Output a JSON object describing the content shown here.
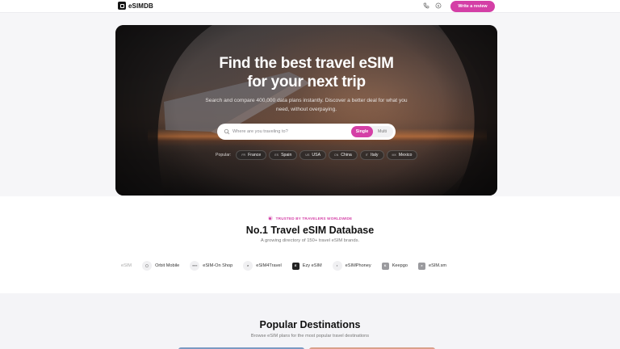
{
  "header": {
    "brand": "eSIMDB",
    "icons": [
      "phone-icon",
      "dollar-icon"
    ],
    "cta_label": "Write a review",
    "accent": "#d43fa6"
  },
  "hero": {
    "title_line1": "Find the best travel eSIM",
    "title_line2": "for your next trip",
    "subtitle": "Search and compare 400,000 data plans instantly. Discover a better deal for what you need, without overpaying.",
    "search_placeholder": "Where are you traveling to?",
    "toggle": {
      "single": "Single",
      "multi": "Multi",
      "selected": "Single"
    },
    "popular_label": "Popular:",
    "popular": [
      {
        "code": "FR",
        "name": "France"
      },
      {
        "code": "ES",
        "name": "Spain"
      },
      {
        "code": "US",
        "name": "USA"
      },
      {
        "code": "CN",
        "name": "China"
      },
      {
        "code": "IT",
        "name": "Italy"
      },
      {
        "code": "MX",
        "name": "Mexico"
      }
    ]
  },
  "trusted": {
    "badge": "TRUSTED BY TRAVELERS WORLDWIDE",
    "title": "No.1 Travel eSIM Database",
    "subtitle": "A growing directory of 150+ travel eSIM brands.",
    "brands": [
      {
        "name": "eSIM-On Shop",
        "logo": "≡≡≡",
        "style": "plain"
      },
      {
        "name": "eSIM4Travel",
        "logo": "e",
        "style": "circle"
      },
      {
        "name": "Ezy eSIM",
        "logo": "E",
        "style": "sq"
      },
      {
        "name": "eSIMPhoney",
        "logo": "◐",
        "style": "circle"
      },
      {
        "name": "Keepgo",
        "logo": "K",
        "style": "gray"
      },
      {
        "name": "eSIM.sm",
        "logo": "e",
        "style": "gray"
      }
    ],
    "brand_partial_left": "Orbit Mobile",
    "brand_fade_left": "eSIM"
  },
  "destinations": {
    "title": "Popular Destinations",
    "subtitle": "Browse eSIM plans for the most popular travel destinations"
  }
}
